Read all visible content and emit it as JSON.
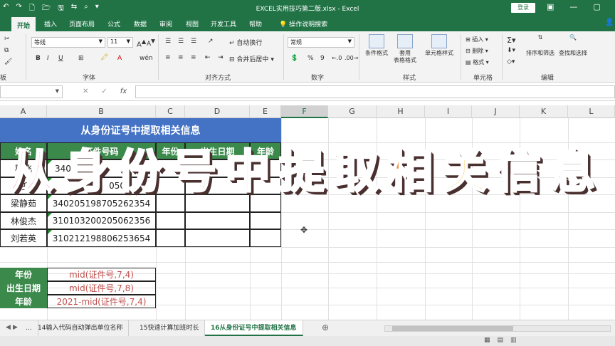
{
  "titlebar": {
    "title": "EXCEL实用技巧第二版.xlsx  -  Excel",
    "login": "登录",
    "qat": [
      "↶",
      "↷",
      "🗋",
      "🗁",
      "🖫",
      "⇆",
      "⌕",
      "▾"
    ],
    "win": [
      "▣",
      "—",
      "▢",
      "✕"
    ]
  },
  "tabs": [
    "开始",
    "插入",
    "页面布局",
    "公式",
    "数据",
    "审阅",
    "视图",
    "开发工具",
    "帮助",
    "操作说明搜索"
  ],
  "share_icon": "user-icon",
  "ribbon": {
    "font_name": "等线",
    "font_size": "11",
    "font_group": "字体",
    "align_group": "对齐方式",
    "wrap": "自动换行",
    "merge": "合并后居中",
    "number_format": "常规",
    "number_group": "数字",
    "percent": "%",
    "comma": "9",
    "styles_group": "样式",
    "cond_fmt": "条件格式",
    "table_fmt": "套用\n表格格式",
    "cell_style": "单元格样式",
    "cells_group": "单元格",
    "insert": "插入",
    "delete": "删除",
    "format": "格式",
    "edit_group": "编辑",
    "sort": "排序和筛选",
    "find": "查找和选择",
    "bold": "B",
    "italic": "I",
    "underline": "U",
    "clipboard_group": "板"
  },
  "formula_bar": {
    "icons": [
      "✕",
      "✓",
      "fx"
    ],
    "value": ""
  },
  "columns": [
    "A",
    "B",
    "C",
    "D",
    "E",
    "F",
    "G",
    "H",
    "I",
    "J",
    "K",
    "L"
  ],
  "selected_column": "F",
  "table": {
    "title": "从身份证号中提取相关信息",
    "headers": [
      "姓名",
      "证件号码",
      "年份",
      "出生日期",
      "年龄"
    ],
    "rows": [
      {
        "name": "程飞",
        "id": "340"
      },
      {
        "name": "任",
        "id": "050"
      },
      {
        "name": "梁静茹",
        "id": "340205198705262354"
      },
      {
        "name": "林俊杰",
        "id": "310103200205062356"
      },
      {
        "name": "刘若英",
        "id": "310212198806253654"
      }
    ]
  },
  "formulas": [
    {
      "label": "年份",
      "formula": "mid(证件号,7,4)"
    },
    {
      "label": "出生日期",
      "formula": "mid(证件号,7,8)"
    },
    {
      "label": "年龄",
      "formula": "2021-mid(证件号,7,4)"
    }
  ],
  "overlay": {
    "chars": [
      "从",
      "身",
      "份",
      "号",
      "中",
      "提",
      "取",
      "相",
      "关",
      "信",
      "息"
    ],
    "colors": [
      "#e8578b",
      "#f2a0c2",
      "#f6c54a",
      "#5cb85c",
      "#4a9fd9",
      "#f2a0c2",
      "#e8578b",
      "#f08a3c",
      "#f6c54a",
      "#5cb85c",
      "#4a9fd9"
    ]
  },
  "sheet_tabs": [
    "...",
    "14输入代码自动弹出单位名称",
    "15快速计算加班时长",
    "16从身份证号中提取相关信息"
  ],
  "active_sheet": "16从身份证号中提取相关信息",
  "add_sheet": "⊕",
  "nav": [
    "◀",
    "▶"
  ],
  "status": [
    "▦",
    "▤",
    "▥"
  ]
}
